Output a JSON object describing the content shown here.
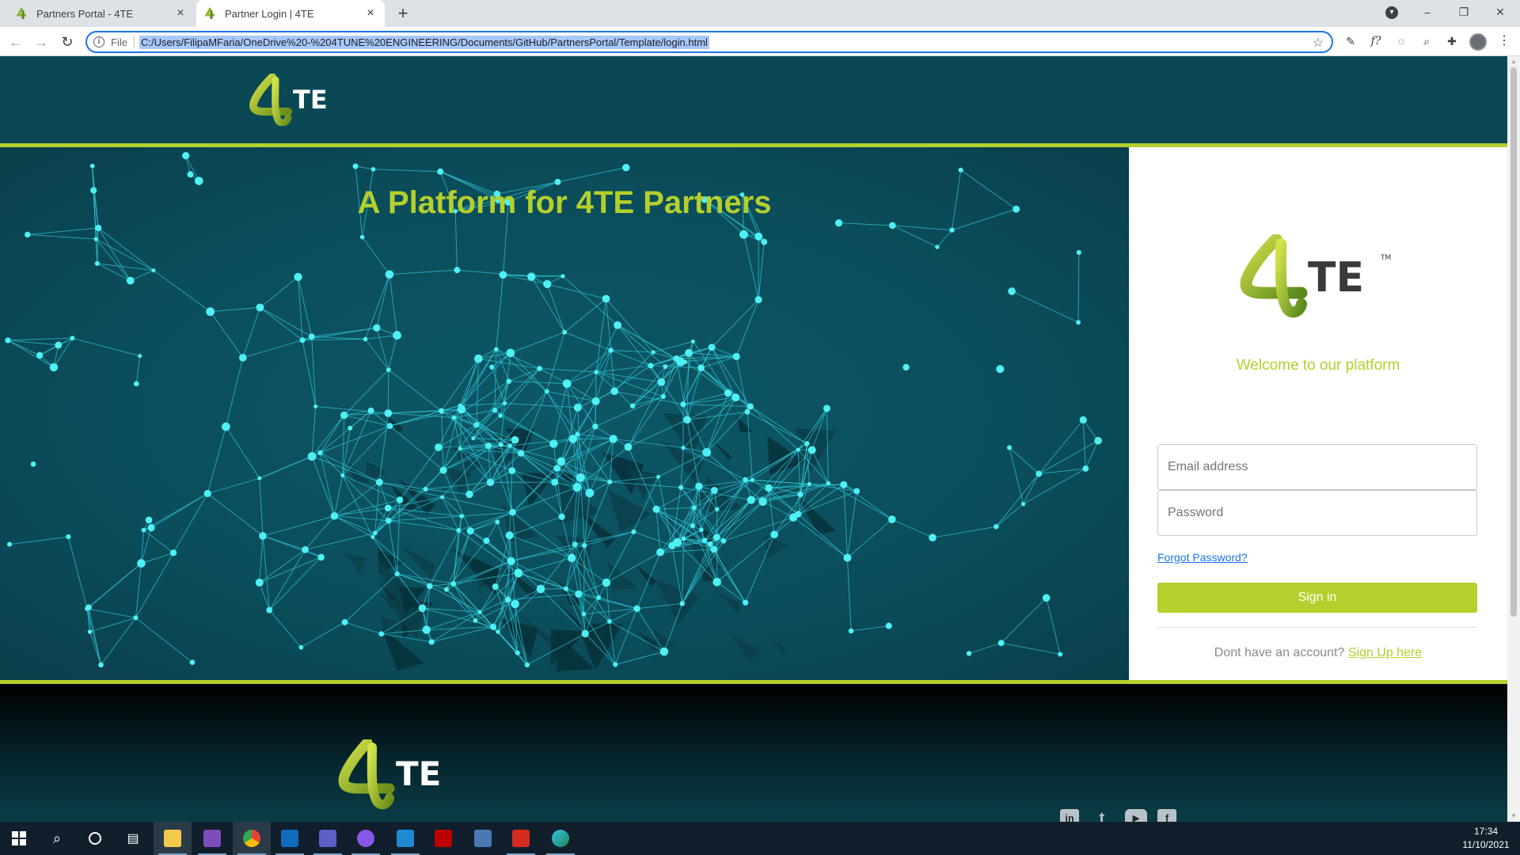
{
  "browser": {
    "tabs": [
      {
        "title": "Partners Portal - 4TE",
        "close": "×"
      },
      {
        "title": "Partner Login | 4TE",
        "close": "×"
      }
    ],
    "new_tab": "+",
    "address": {
      "scheme_label": "File",
      "url": "C:/Users/FilipaMFaria/OneDrive%20-%204TUNE%20ENGINEERING/Documents/GitHub/PartnersPortal/Template/login.html"
    },
    "window_controls": {
      "minimize": "–",
      "restore": "❐",
      "close": "✕"
    }
  },
  "page": {
    "hero_title": "A Platform for 4TE Partners",
    "logo_text": "TE",
    "logo_tm": "TM",
    "welcome": "Welcome to our platform",
    "email_placeholder": "Email address",
    "password_placeholder": "Password",
    "forgot_password": "Forgot Password?",
    "signin_label": "Sign in",
    "signup_prompt": "Dont have an account?",
    "signup_link": "Sign Up here",
    "social": [
      "in",
      "t",
      "▶",
      "f"
    ],
    "colors": {
      "brand_green": "#b5cf2d",
      "teal": "#0a4856"
    }
  },
  "taskbar": {
    "time": "17:34",
    "date": "11/10/2021"
  }
}
